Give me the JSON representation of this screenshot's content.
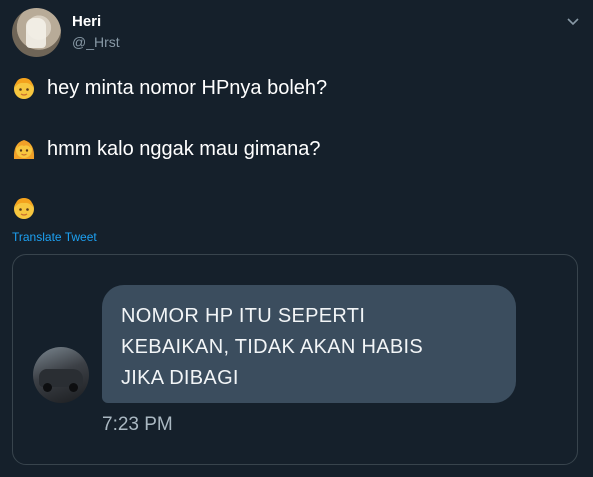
{
  "author": {
    "name": "Heri",
    "handle": "@_Hrst"
  },
  "tweet": {
    "lines": [
      {
        "emoji": "boy-face-icon",
        "text": "hey minta nomor HPnya boleh?"
      },
      {
        "emoji": "girl-face-icon",
        "text": "hmm kalo nggak mau gimana?"
      },
      {
        "emoji": "boy-face-icon",
        "text": ""
      }
    ],
    "translate_label": "Translate Tweet"
  },
  "media": {
    "bubble_lines": [
      "NOMOR HP ITU SEPERTI",
      "KEBAIKAN, TIDAK AKAN HABIS",
      "JIKA DIBAGI"
    ],
    "time": "7:23 PM"
  },
  "colors": {
    "background": "#15202b",
    "accent": "#1da1f2",
    "secondary_text": "#8899a6",
    "bubble": "#3b4d5e",
    "border": "#38444d"
  }
}
